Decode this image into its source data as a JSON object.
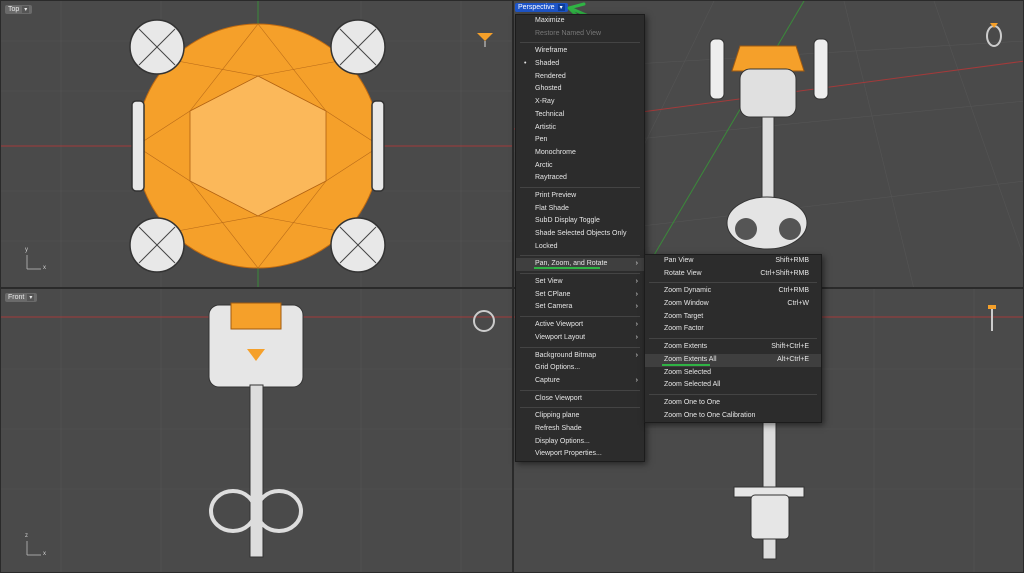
{
  "viewports": {
    "top": {
      "label": "Top"
    },
    "front": {
      "label": "Front"
    },
    "perspective": {
      "label": "Perspective"
    }
  },
  "axes": {
    "x": "x",
    "y": "y",
    "z": "z"
  },
  "context_menu": {
    "items": [
      {
        "label": "Maximize"
      },
      {
        "label": "Restore Named View",
        "disabled": true
      },
      {
        "sep": true
      },
      {
        "label": "Wireframe"
      },
      {
        "label": "Shaded",
        "checked": true
      },
      {
        "label": "Rendered"
      },
      {
        "label": "Ghosted"
      },
      {
        "label": "X-Ray"
      },
      {
        "label": "Technical"
      },
      {
        "label": "Artistic"
      },
      {
        "label": "Pen"
      },
      {
        "label": "Monochrome"
      },
      {
        "label": "Arctic"
      },
      {
        "label": "Raytraced"
      },
      {
        "sep": true
      },
      {
        "label": "Print Preview"
      },
      {
        "label": "Flat Shade"
      },
      {
        "label": "SubD Display Toggle"
      },
      {
        "label": "Shade Selected Objects Only"
      },
      {
        "label": "Locked"
      },
      {
        "sep": true
      },
      {
        "label": "Pan, Zoom, and Rotate",
        "submenu": true,
        "highlighted": true
      },
      {
        "sep": true
      },
      {
        "label": "Set View",
        "submenu": true
      },
      {
        "label": "Set CPlane",
        "submenu": true
      },
      {
        "label": "Set Camera",
        "submenu": true
      },
      {
        "sep": true
      },
      {
        "label": "Active Viewport",
        "submenu": true
      },
      {
        "label": "Viewport Layout",
        "submenu": true
      },
      {
        "sep": true
      },
      {
        "label": "Background Bitmap",
        "submenu": true
      },
      {
        "label": "Grid Options..."
      },
      {
        "label": "Capture",
        "submenu": true
      },
      {
        "sep": true
      },
      {
        "label": "Close Viewport"
      },
      {
        "sep": true
      },
      {
        "label": "Clipping plane"
      },
      {
        "label": "Refresh Shade"
      },
      {
        "label": "Display Options..."
      },
      {
        "label": "Viewport Properties..."
      }
    ]
  },
  "submenu": {
    "items": [
      {
        "label": "Pan View",
        "shortcut": "Shift+RMB"
      },
      {
        "label": "Rotate View",
        "shortcut": "Ctrl+Shift+RMB"
      },
      {
        "sep": true
      },
      {
        "label": "Zoom Dynamic",
        "shortcut": "Ctrl+RMB"
      },
      {
        "label": "Zoom Window",
        "shortcut": "Ctrl+W"
      },
      {
        "label": "Zoom Target",
        "shortcut": ""
      },
      {
        "label": "Zoom Factor",
        "shortcut": ""
      },
      {
        "sep": true
      },
      {
        "label": "Zoom Extents",
        "shortcut": "Shift+Ctrl+E"
      },
      {
        "label": "Zoom Extents All",
        "shortcut": "Alt+Ctrl+E",
        "highlighted": true
      },
      {
        "label": "Zoom Selected",
        "shortcut": ""
      },
      {
        "label": "Zoom Selected All",
        "shortcut": ""
      },
      {
        "sep": true
      },
      {
        "label": "Zoom One to One",
        "shortcut": ""
      },
      {
        "label": "Zoom One to One Calibration",
        "shortcut": ""
      }
    ]
  },
  "colors": {
    "gem": "#f5a02a",
    "active_tab": "#1e55c8",
    "annotation": "#2fb344",
    "grid_x_axis": "#a33a3a",
    "grid_y_axis": "#3a8a3a"
  }
}
